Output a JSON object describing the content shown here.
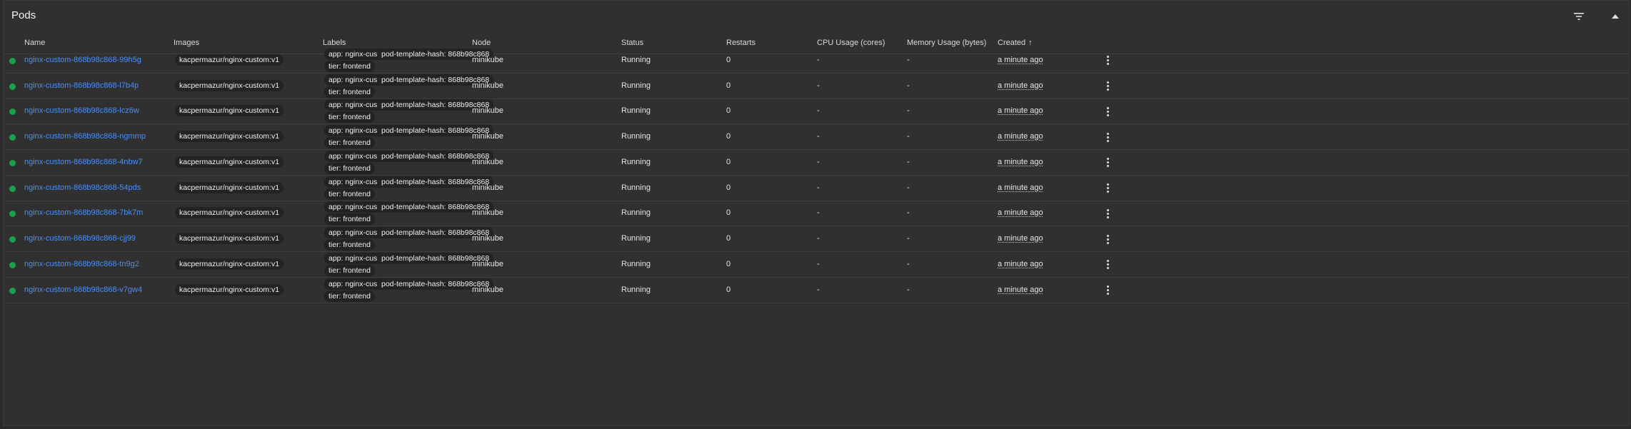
{
  "panel": {
    "title": "Pods",
    "filter_icon": "filter-icon",
    "collapse_icon": "chevron-up-icon"
  },
  "table": {
    "columns": {
      "name": "Name",
      "images": "Images",
      "labels": "Labels",
      "node": "Node",
      "status": "Status",
      "restarts": "Restarts",
      "cpu": "CPU Usage (cores)",
      "memory": "Memory Usage (bytes)",
      "created": "Created"
    },
    "sort_arrow": "↑",
    "status_color": "#16a34a",
    "link_color": "#4d8ef0",
    "rows": [
      {
        "name": "nginx-custom-868b98c868-99h5g",
        "image": "kacpermazur/nginx-custom:v1",
        "label_app": "app: nginx-custom",
        "label_hash": "pod-template-hash: 868b98c868",
        "label_tier": "tier: frontend",
        "node": "minikube",
        "status": "Running",
        "restarts": "0",
        "cpu": "-",
        "memory": "-",
        "created": "a minute ago"
      },
      {
        "name": "nginx-custom-868b98c868-l7b4p",
        "image": "kacpermazur/nginx-custom:v1",
        "label_app": "app: nginx-custom",
        "label_hash": "pod-template-hash: 868b98c868",
        "label_tier": "tier: frontend",
        "node": "minikube",
        "status": "Running",
        "restarts": "0",
        "cpu": "-",
        "memory": "-",
        "created": "a minute ago"
      },
      {
        "name": "nginx-custom-868b98c868-lcz6w",
        "image": "kacpermazur/nginx-custom:v1",
        "label_app": "app: nginx-custom",
        "label_hash": "pod-template-hash: 868b98c868",
        "label_tier": "tier: frontend",
        "node": "minikube",
        "status": "Running",
        "restarts": "0",
        "cpu": "-",
        "memory": "-",
        "created": "a minute ago"
      },
      {
        "name": "nginx-custom-868b98c868-ngmmp",
        "image": "kacpermazur/nginx-custom:v1",
        "label_app": "app: nginx-custom",
        "label_hash": "pod-template-hash: 868b98c868",
        "label_tier": "tier: frontend",
        "node": "minikube",
        "status": "Running",
        "restarts": "0",
        "cpu": "-",
        "memory": "-",
        "created": "a minute ago"
      },
      {
        "name": "nginx-custom-868b98c868-4nbw7",
        "image": "kacpermazur/nginx-custom:v1",
        "label_app": "app: nginx-custom",
        "label_hash": "pod-template-hash: 868b98c868",
        "label_tier": "tier: frontend",
        "node": "minikube",
        "status": "Running",
        "restarts": "0",
        "cpu": "-",
        "memory": "-",
        "created": "a minute ago"
      },
      {
        "name": "nginx-custom-868b98c868-54pds",
        "image": "kacpermazur/nginx-custom:v1",
        "label_app": "app: nginx-custom",
        "label_hash": "pod-template-hash: 868b98c868",
        "label_tier": "tier: frontend",
        "node": "minikube",
        "status": "Running",
        "restarts": "0",
        "cpu": "-",
        "memory": "-",
        "created": "a minute ago"
      },
      {
        "name": "nginx-custom-868b98c868-7bk7m",
        "image": "kacpermazur/nginx-custom:v1",
        "label_app": "app: nginx-custom",
        "label_hash": "pod-template-hash: 868b98c868",
        "label_tier": "tier: frontend",
        "node": "minikube",
        "status": "Running",
        "restarts": "0",
        "cpu": "-",
        "memory": "-",
        "created": "a minute ago"
      },
      {
        "name": "nginx-custom-868b98c868-cjj99",
        "image": "kacpermazur/nginx-custom:v1",
        "label_app": "app: nginx-custom",
        "label_hash": "pod-template-hash: 868b98c868",
        "label_tier": "tier: frontend",
        "node": "minikube",
        "status": "Running",
        "restarts": "0",
        "cpu": "-",
        "memory": "-",
        "created": "a minute ago"
      },
      {
        "name": "nginx-custom-868b98c868-tn9g2",
        "image": "kacpermazur/nginx-custom:v1",
        "label_app": "app: nginx-custom",
        "label_hash": "pod-template-hash: 868b98c868",
        "label_tier": "tier: frontend",
        "node": "minikube",
        "status": "Running",
        "restarts": "0",
        "cpu": "-",
        "memory": "-",
        "created": "a minute ago"
      },
      {
        "name": "nginx-custom-868b98c868-v7gw4",
        "image": "kacpermazur/nginx-custom:v1",
        "label_app": "app: nginx-custom",
        "label_hash": "pod-template-hash: 868b98c868",
        "label_tier": "tier: frontend",
        "node": "minikube",
        "status": "Running",
        "restarts": "0",
        "cpu": "-",
        "memory": "-",
        "created": "a minute ago"
      }
    ]
  }
}
